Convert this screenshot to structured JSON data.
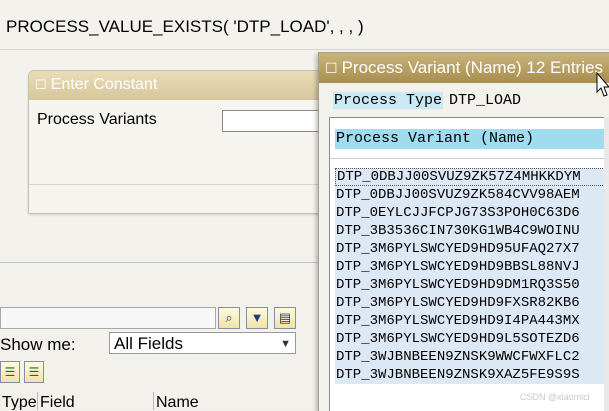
{
  "formula": {
    "text": "PROCESS_VALUE_EXISTS( 'DTP_LOAD', , , )"
  },
  "enter_constant": {
    "title": "Enter Constant",
    "field_label": "Process Variants",
    "field_value": ""
  },
  "toolbar": {
    "buttons": [
      "binoculars-icon",
      "filter-icon",
      "filter-save-icon"
    ],
    "show_me_label": "Show me:",
    "show_me_value": "All Fields",
    "small_buttons": [
      "expand-all-icon",
      "collapse-all-icon"
    ]
  },
  "columns": [
    "Type",
    "Field",
    "Name"
  ],
  "popup": {
    "title": "Process Variant (Name) 12 Entries",
    "process_type_label": "Process Type",
    "process_type_value": "DTP_LOAD",
    "list_header": "Process Variant (Name)",
    "items": [
      "DTP_0DBJJ00SVUZ9ZK57Z4MHKKDYM",
      "DTP_0DBJJ00SVUZ9ZK584CVV98AEM",
      "DTP_0EYLCJJFCPJG73S3POH0C63D6",
      "DTP_3B3536CIN730KG1WB4C9WOINU",
      "DTP_3M6PYLSWCYED9HD95UFAQ27X7",
      "DTP_3M6PYLSWCYED9HD9BBSL88NVJ",
      "DTP_3M6PYLSWCYED9HD9DM1RQ3S50",
      "DTP_3M6PYLSWCYED9HD9FXSR82KB6",
      "DTP_3M6PYLSWCYED9HD9I4PA443MX",
      "DTP_3M6PYLSWCYED9HD9L5SOTEZD6",
      "DTP_3WJBNBEEN9ZNSK9WWCFWXFLC2",
      "DTP_3WJBNBEEN9ZNSK9XAZ5FE9S9S"
    ]
  },
  "watermark": "CSDN @xiaomici",
  "colors": {
    "highlight": "#9fdcf0",
    "list_row": "#dde8f5",
    "title_gold": "#b89e5f"
  }
}
